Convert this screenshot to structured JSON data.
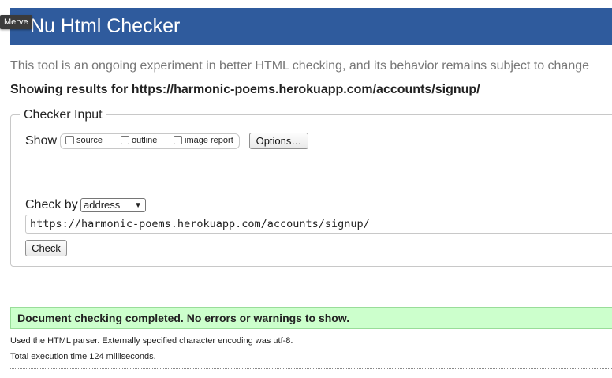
{
  "header": {
    "title": "Nu Html Checker",
    "tooltip": "Merve"
  },
  "intro": "This tool is an ongoing experiment in better HTML checking, and its behavior remains subject to change",
  "results_for": "Showing results for https://harmonic-poems.herokuapp.com/accounts/signup/",
  "checker_input": {
    "legend": "Checker Input",
    "show_label": "Show",
    "options": [
      {
        "label": "source",
        "checked": false
      },
      {
        "label": "outline",
        "checked": false
      },
      {
        "label": "image report",
        "checked": false
      }
    ],
    "options_button": "Options…",
    "check_by_label": "Check by",
    "check_by_value": "address",
    "url_value": "https://harmonic-poems.herokuapp.com/accounts/signup/",
    "check_button": "Check"
  },
  "result": {
    "message": "Document checking completed. No errors or warnings to show.",
    "parser_info": "Used the HTML parser. Externally specified character encoding was utf-8.",
    "execution_time": "Total execution time 124 milliseconds."
  },
  "colors": {
    "header_bg": "#2f5b9d",
    "success_bg": "#ccffcc"
  }
}
